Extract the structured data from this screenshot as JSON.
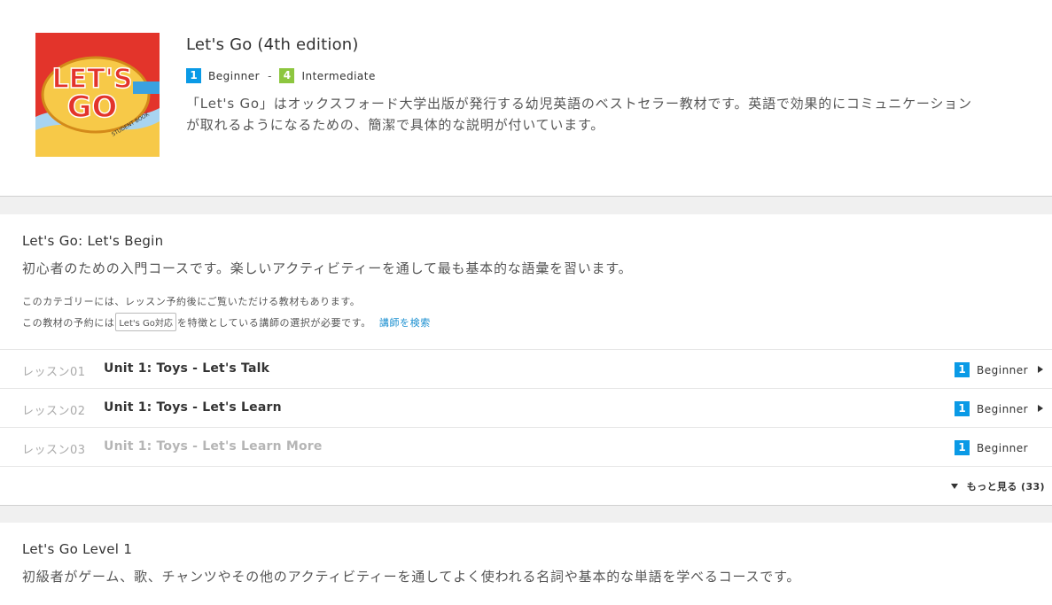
{
  "book": {
    "title": "Let's Go (4th edition)",
    "level_from_num": "1",
    "level_from": "Beginner",
    "level_sep": "-",
    "level_to_num": "4",
    "level_to": "Intermediate",
    "description_line1": "「Let's Go」はオックスフォード大学出版が発行する幼児英語のベストセラー教材です。英語で効果的にコミュニケーション",
    "description_line2": "が取れるようになるための、簡潔で具体的な説明が付いています。",
    "cover_text_1": "LET'S",
    "cover_text_2": "GO",
    "cover_text_3": "STUDENT BOOK"
  },
  "course1": {
    "title": "Let's Go: Let's Begin",
    "description": "初心者のための入門コースです。楽しいアクティビティーを通して最も基本的な語彙を習います。",
    "note1": "このカテゴリーには、レッスン予約後にご覧いただける教材もあります。",
    "note2_pre": "この教材の予約には",
    "note2_tag": "Let's Go対応",
    "note2_post": "を特徴としている講師の選択が必要です。",
    "search_link": "講師を検索",
    "lessons": [
      {
        "num": "レッスン01",
        "name": "Unit 1: Toys - Let's Talk",
        "level_num": "1",
        "level": "Beginner"
      },
      {
        "num": "レッスン02",
        "name": "Unit 1: Toys - Let's Learn",
        "level_num": "1",
        "level": "Beginner"
      },
      {
        "num": "レッスン03",
        "name": "Unit 1: Toys - Let's Learn More",
        "level_num": "1",
        "level": "Beginner"
      }
    ],
    "more_label": "もっと見る (33)"
  },
  "course2": {
    "title": "Let's Go Level 1",
    "description": "初級者がゲーム、歌、チャンツやその他のアクティビティーを通してよく使われる名詞や基本的な単語を学べるコースです。"
  },
  "colors": {
    "beginner": "#0a9ae6",
    "intermediate": "#8dc63f",
    "link": "#1a8fd0"
  }
}
